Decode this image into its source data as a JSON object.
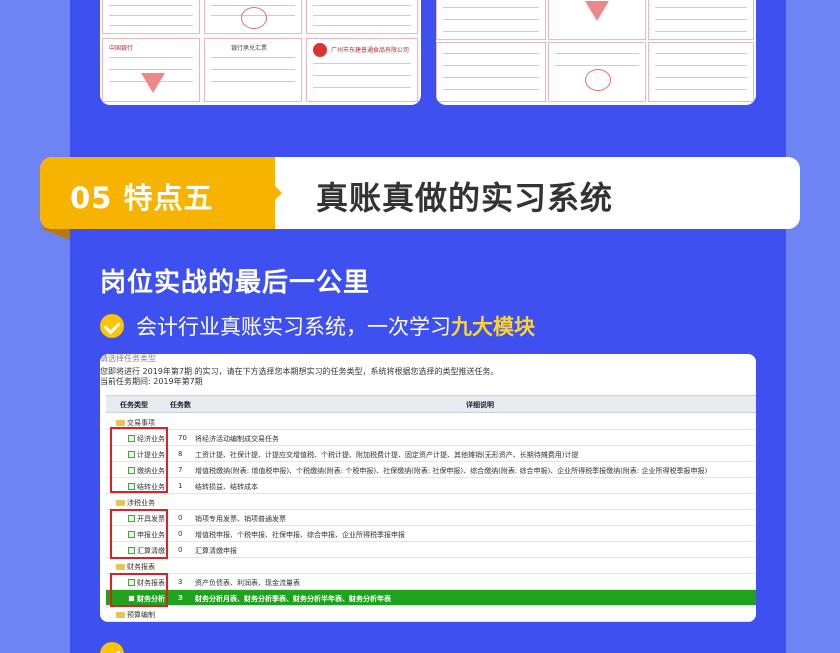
{
  "banner": {
    "tag": "05 特点五",
    "title": "真账真做的实习系统"
  },
  "section_title": "岗位实战的最后一公里",
  "bullet": {
    "prefix": "会计行业真账实习系统，一次学习",
    "highlight": "九大模块"
  },
  "thumb_docs": {
    "bank": "中国银行",
    "remit": "银行承兑汇票",
    "company": "广州市东建普通食品有限公司"
  },
  "screenshot": {
    "caption_top": "请选择任务类型",
    "caption_line1": "您即将进行 2019年第7期 的实习，请在下方选择您本期想实习的任务类型，系统将根据您选择的类型推送任务。",
    "caption_line2": "当前任务期间: 2019年第7期",
    "headers": {
      "type": "任务类型",
      "count": "任务数",
      "detail": "详细说明"
    },
    "rows": [
      {
        "kind": "group",
        "label": "交易事项"
      },
      {
        "kind": "item",
        "label": "经济业务",
        "count": "70",
        "detail": "将经济活动编制成交易任务"
      },
      {
        "kind": "item",
        "label": "计提业务",
        "count": "8",
        "detail": "工资计提、社保计提、计提应交增值税、个税计提、附加税费计提、固定资产计提、其他摊销(无形资产、长期待摊费用)计提"
      },
      {
        "kind": "item",
        "label": "缴纳业务",
        "count": "7",
        "detail": "增值税缴纳(附表: 增值税申报)、个税缴纳(附表: 个税申报)、社保缴纳(附表: 社保申报)、综合缴纳(附表: 综合申报)、企业所得税季报缴纳(附表: 企业所得税季报申报)"
      },
      {
        "kind": "item",
        "label": "结转业务",
        "count": "1",
        "detail": "结转损益、结转成本"
      },
      {
        "kind": "group",
        "label": "涉税业务"
      },
      {
        "kind": "item",
        "label": "开具发票",
        "count": "0",
        "detail": "销项专用发票、销项普通发票"
      },
      {
        "kind": "item",
        "label": "申报业务",
        "count": "0",
        "detail": "增值税申报、个税申报、社保申报、综合申报、企业所得税季报申报"
      },
      {
        "kind": "item",
        "label": "汇算清缴",
        "count": "0",
        "detail": "汇算清缴申报"
      },
      {
        "kind": "group",
        "label": "财务报表"
      },
      {
        "kind": "item",
        "label": "财务报表",
        "count": "3",
        "detail": "资产负债表、利润表、现金流量表"
      },
      {
        "kind": "item",
        "label": "财务分析",
        "count": "3",
        "detail": "财务分析月表、财务分析季表、财务分析半年表、财务分析年表",
        "selected": true
      },
      {
        "kind": "group",
        "label": "预算编制"
      }
    ]
  },
  "colors": {
    "panel": "#3f50f0",
    "background": "#6f84f4",
    "accent": "#f6b400",
    "highlight": "#ffd52a",
    "selected_row": "#1fa31f"
  }
}
